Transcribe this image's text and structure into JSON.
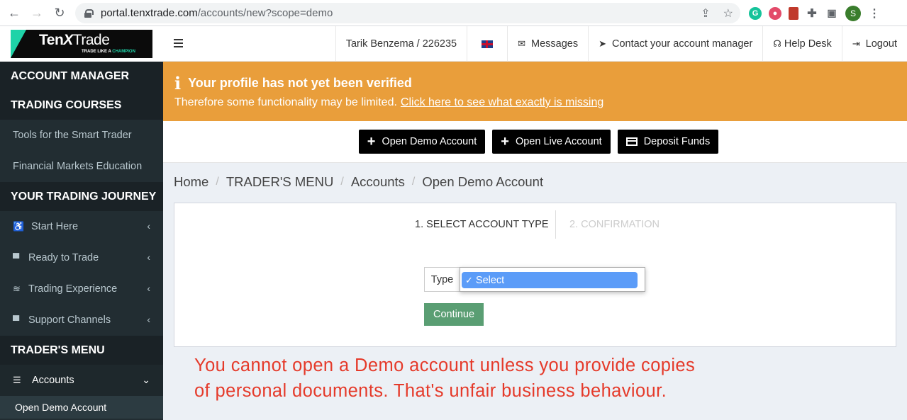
{
  "browser": {
    "url_host": "portal.tenxtrade.com",
    "url_path": "/accounts/new?scope=demo",
    "profile_initial": "S"
  },
  "logo": {
    "text_a": "Ten",
    "text_x": "X",
    "text_b": "Trade",
    "tagline_a": "TRADE LIKE A ",
    "tagline_b": "CHAMPION"
  },
  "sidebar": {
    "account_manager": "ACCOUNT MANAGER",
    "trading_courses": "TRADING COURSES",
    "course_items": [
      "Tools for the Smart Trader",
      "Financial Markets Education"
    ],
    "journey_header": "YOUR TRADING JOURNEY",
    "journey_items": [
      "Start Here",
      "Ready to Trade",
      "Trading Experience",
      "Support Channels"
    ],
    "traders_menu": "TRADER'S MENU",
    "accounts": "Accounts",
    "open_demo": "Open Demo Account"
  },
  "topbar": {
    "user": "Tarik Benzema / 226235",
    "messages": "Messages",
    "contact": "Contact your account manager",
    "help": "Help Desk",
    "logout": "Logout"
  },
  "alert": {
    "title": "Your profile has not yet been verified",
    "text": "Therefore some functionality may be limited.",
    "link": "Click here to see what exactly is missing",
    "color": "#e99e3b"
  },
  "actions": {
    "open_demo": "Open Demo Account",
    "open_live": "Open Live Account",
    "deposit": "Deposit Funds"
  },
  "breadcrumb": [
    "Home",
    "TRADER'S MENU",
    "Accounts",
    "Open Demo Account"
  ],
  "form": {
    "step1": "1. SELECT ACCOUNT TYPE",
    "step2": "2. CONFIRMATION",
    "type_label": "Type",
    "selected_option": "Select",
    "continue": "Continue"
  },
  "annotation": {
    "line1": "You cannot open a Demo account unless you provide copies",
    "line2": "of personal documents. That's unfair business behaviour."
  }
}
